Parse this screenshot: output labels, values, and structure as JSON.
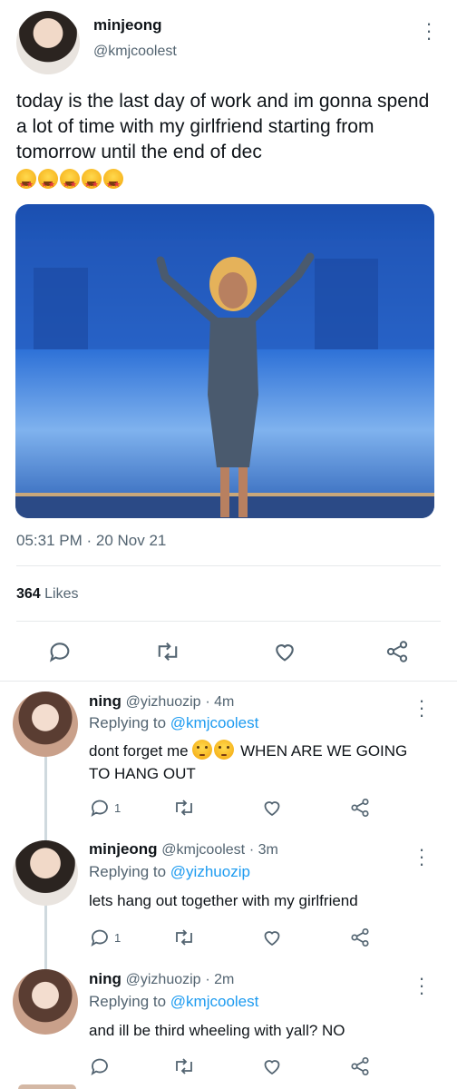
{
  "tweet": {
    "author_name": "minjeong",
    "author_handle": "@kmjcoolest",
    "text": "today is the last day of work and im gonna spend a lot of time with my girlfriend starting from tomorrow until the end of dec",
    "emoji_icons": [
      "star-struck-emoji",
      "star-struck-emoji",
      "star-struck-emoji",
      "star-struck-emoji",
      "star-struck-emoji"
    ],
    "timestamp": "05:31 PM · 20 Nov 21",
    "likes_count": "364",
    "likes_label": "Likes",
    "actions": [
      "reply-icon",
      "retweet-icon",
      "like-icon",
      "share-icon"
    ]
  },
  "replies": [
    {
      "name": "ning",
      "handle": "@yizhuozip",
      "time": "· 4m",
      "replying_prefix": "Replying to",
      "replying_to": "@kmjcoolest",
      "text_before": "dont forget me",
      "emoji_icons": [
        "flushed-emoji",
        "flushed-emoji"
      ],
      "text_after": "WHEN ARE WE GOING TO HANG OUT",
      "reply_count": "1"
    },
    {
      "name": "minjeong",
      "handle": "@kmjcoolest",
      "time": "· 3m",
      "replying_prefix": "Replying to",
      "replying_to": "@yizhuozip",
      "text": "lets hang out together with my girlfriend",
      "reply_count": "1"
    },
    {
      "name": "ning",
      "handle": "@yizhuozip",
      "time": "· 2m",
      "replying_prefix": "Replying to",
      "replying_to": "@kmjcoolest",
      "text": "and ill be third wheeling with yall? NO",
      "reply_count": ""
    }
  ],
  "colors": {
    "link": "#1d9bf0",
    "muted": "#536471",
    "divider": "#e6e9eb",
    "image_bg": "#1e63c8"
  }
}
